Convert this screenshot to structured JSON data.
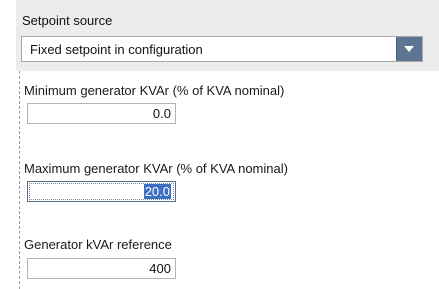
{
  "setpoint": {
    "title": "Setpoint source",
    "selected": "Fixed setpoint in configuration"
  },
  "fields": {
    "min_kvar": {
      "label": "Minimum generator KVAr (% of KVA nominal)",
      "value": "0.0"
    },
    "max_kvar": {
      "label": "Maximum generator KVAr (% of KVA nominal)",
      "value": "20.0"
    },
    "kvar_ref": {
      "label": "Generator kVAr reference",
      "value": "400"
    }
  },
  "colors": {
    "panel_bg": "#ececec",
    "dropdown_button": "#5d7591",
    "selection_highlight": "#3f6ec6"
  },
  "icons": {
    "dropdown": "chevron-down-icon"
  }
}
